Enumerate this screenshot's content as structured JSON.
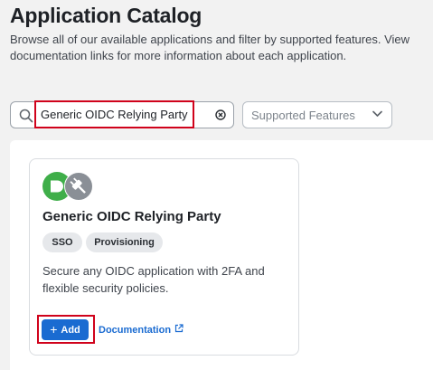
{
  "header": {
    "title": "Application Catalog",
    "subtitle": "Browse all of our available applications and filter by supported features. View documentation links for more information about each application."
  },
  "search": {
    "value": "Generic OIDC Relying Party",
    "icon": "search-icon",
    "clear_icon": "clear-circle-icon"
  },
  "filter": {
    "placeholder": "Supported Features",
    "icon": "chevron-down-icon"
  },
  "card": {
    "title": "Generic OIDC Relying Party",
    "tags": [
      "SSO",
      "Provisioning"
    ],
    "description": "Secure any OIDC application with 2FA and flexible security policies.",
    "add_label": "Add",
    "doc_label": "Documentation"
  },
  "colors": {
    "accent": "#1a6bd1",
    "highlight": "#d0021b",
    "logo_green": "#3fae49",
    "logo_gray": "#8a8f96"
  }
}
